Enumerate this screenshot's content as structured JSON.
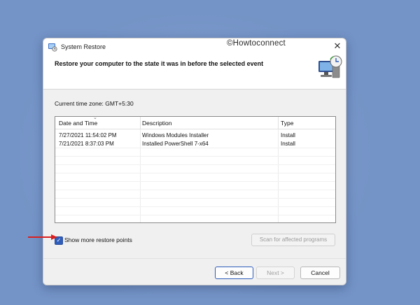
{
  "window": {
    "title": "System Restore",
    "watermark": "©Howtoconnect",
    "close_glyph": "✕"
  },
  "header": {
    "heading": "Restore your computer to the state it was in before the selected event"
  },
  "timezone": "Current time zone: GMT+5:30",
  "table": {
    "columns": [
      "Date and Time",
      "Description",
      "Type"
    ],
    "rows": [
      {
        "date": "7/27/2021 11:54:02 PM",
        "description": "Windows Modules Installer",
        "type": "Install"
      },
      {
        "date": "7/21/2021 8:37:03 PM",
        "description": "Installed PowerShell 7-x64",
        "type": "Install"
      }
    ]
  },
  "options": {
    "show_more_label": "Show more restore points",
    "show_more_checked": true,
    "scan_label": "Scan for affected programs"
  },
  "footer": {
    "back_label": "< Back",
    "next_label": "Next >",
    "cancel_label": "Cancel"
  },
  "colors": {
    "desktop": "#7493c6",
    "accent": "#2f5dba",
    "annotation_arrow": "#d92020"
  },
  "icons": [
    "system-restore-icon",
    "computer-restore-graphic",
    "close-icon",
    "checkmark-icon",
    "sort-arrow-icon",
    "red-arrow-icon"
  ]
}
